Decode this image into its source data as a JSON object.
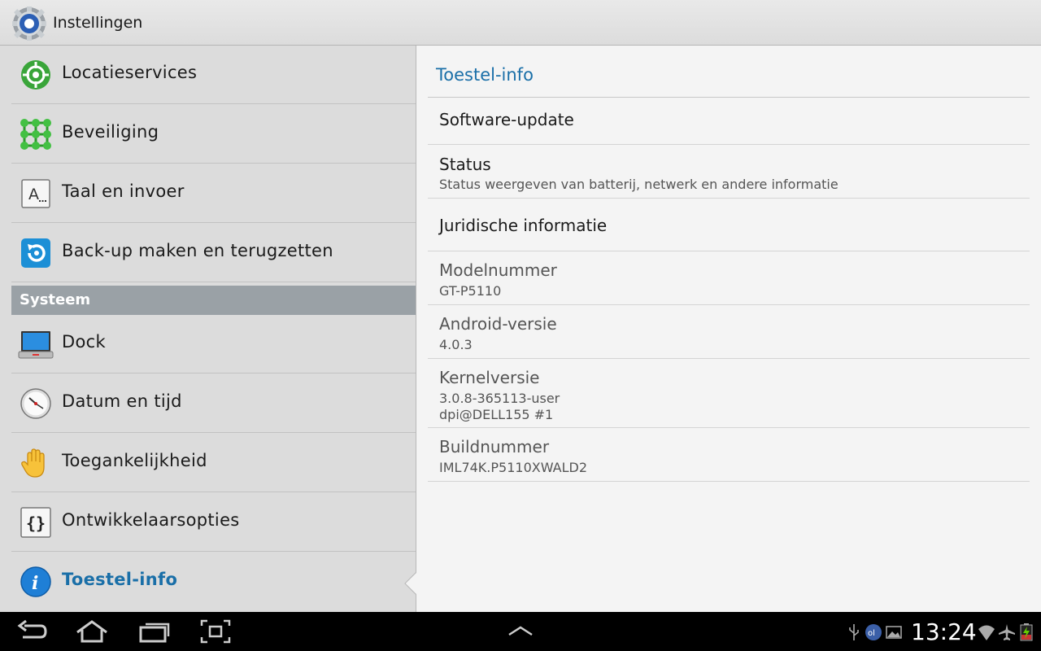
{
  "app": {
    "title": "Instellingen"
  },
  "sidebar": {
    "items": [
      {
        "label": "Locatieservices",
        "icon": "location-target-icon"
      },
      {
        "label": "Beveiliging",
        "icon": "security-grid-icon"
      },
      {
        "label": "Taal en invoer",
        "icon": "language-keyboard-icon"
      },
      {
        "label": "Back-up maken en terugzetten",
        "icon": "backup-restore-icon"
      }
    ],
    "section_header": "Systeem",
    "system_items": [
      {
        "label": "Dock",
        "icon": "dock-monitor-icon"
      },
      {
        "label": "Datum en tijd",
        "icon": "clock-icon"
      },
      {
        "label": "Toegankelijkheid",
        "icon": "hand-icon"
      },
      {
        "label": "Ontwikkelaarsopties",
        "icon": "braces-icon"
      },
      {
        "label": "Toestel-info",
        "icon": "info-icon",
        "selected": true
      }
    ]
  },
  "detail": {
    "title": "Toestel-info",
    "rows": [
      {
        "title": "Software-update"
      },
      {
        "title": "Status",
        "subtitle": "Status weergeven van batterij, netwerk en andere informatie"
      },
      {
        "title": "Juridische informatie"
      },
      {
        "title": "Modelnummer",
        "subtitle": "GT-P5110"
      },
      {
        "title": "Android-versie",
        "subtitle": "4.0.3"
      },
      {
        "title": "Kernelversie",
        "subtitle": "3.0.8-365113-user",
        "subtitle2": "dpi@DELL155 #1"
      },
      {
        "title": "Buildnummer",
        "subtitle": "IML74K.P5110XWALD2"
      }
    ]
  },
  "statusbar": {
    "time": "13:24"
  },
  "colors": {
    "accent": "#1a6fa8",
    "section_header": "#9aa1a6",
    "navbar": "#000000"
  }
}
